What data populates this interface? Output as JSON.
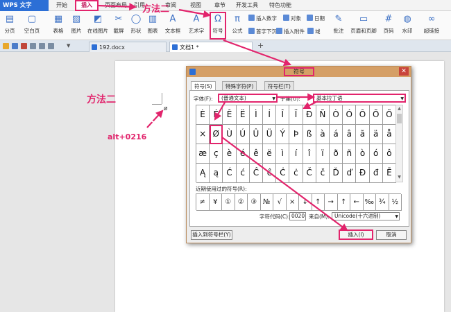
{
  "app": {
    "title": "WPS 文字"
  },
  "menu_tabs": [
    "开始",
    "插入",
    "页面布局",
    "引用",
    "审阅",
    "视图",
    "章节",
    "开发工具",
    "特色功能"
  ],
  "ribbon": {
    "large": [
      "分页",
      "空白页",
      "表格",
      "图片",
      "在线图片",
      "截屏",
      "形状",
      "图表",
      "文本框",
      "艺术字",
      "符号",
      "公式",
      "批注",
      "页眉和页脚",
      "页码",
      "水印",
      "超链接"
    ],
    "small": [
      "插入数字",
      "对象",
      "日期",
      "首字下沉",
      "插入附件",
      "域"
    ],
    "symbol_glyph": "Ω",
    "formula_glyph": "π"
  },
  "doc_tabs": [
    "192.docx",
    "文档1 *"
  ],
  "annotations": {
    "method_one": "方法二",
    "method_two": "方法二",
    "shortcut": "alt+0216"
  },
  "dialog": {
    "title": "符号",
    "tabs": [
      "符号(S)",
      "特殊字符(P)",
      "符号栏(T)"
    ],
    "font_label": "字体(F):",
    "font_value": "(普通文本)",
    "subset_label": "子集(U):",
    "subset_value": "基本拉丁语",
    "grid": [
      [
        "È",
        "É",
        "Ê",
        "Ë",
        "Ì",
        "Í",
        "Î",
        "Ï",
        "Ð",
        "Ñ",
        "Ò",
        "Ó",
        "Ô",
        "Õ",
        "Ö"
      ],
      [
        "×",
        "Ø",
        "Ù",
        "Ú",
        "Û",
        "Ü",
        "Ý",
        "Þ",
        "ß",
        "à",
        "á",
        "â",
        "ã",
        "ä",
        "å"
      ],
      [
        "æ",
        "ç",
        "è",
        "é",
        "ê",
        "ë",
        "ì",
        "í",
        "î",
        "ï",
        "ð",
        "ñ",
        "ò",
        "ó",
        "ô"
      ],
      [
        "Ą",
        "ą",
        "Ć",
        "ć",
        "Ĉ",
        "ĉ",
        "Ċ",
        "ċ",
        "Č",
        "č",
        "Ď",
        "ď",
        "Đ",
        "đ",
        "Ē"
      ]
    ],
    "recent_label": "近期使用过的符号(R):",
    "recent": [
      "≠",
      "¥",
      "①",
      "②",
      "③",
      "№",
      "√",
      "×",
      "↓",
      "↑",
      "→",
      "↑",
      "←",
      "‰",
      "¾",
      "½"
    ],
    "code_label": "字符代码(C):",
    "code_value": "0020",
    "from_label": "来自(M):",
    "from_value": "Unicode(十六进制)",
    "insert_to_bar": "插入到符号栏(Y)",
    "insert": "插入(I)",
    "cancel": "取消"
  }
}
